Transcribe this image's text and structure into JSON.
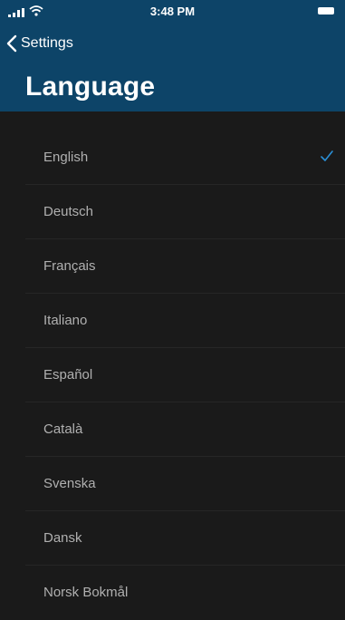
{
  "status_bar": {
    "time": "3:48 PM",
    "signal_icon": "signal-bars-icon",
    "wifi_icon": "wifi-icon",
    "battery_icon": "battery-icon"
  },
  "nav": {
    "back_label": "Settings",
    "back_icon": "chevron-left-icon",
    "title": "Language"
  },
  "languages": [
    {
      "label": "English",
      "selected": true
    },
    {
      "label": "Deutsch",
      "selected": false
    },
    {
      "label": "Français",
      "selected": false
    },
    {
      "label": "Italiano",
      "selected": false
    },
    {
      "label": "Español",
      "selected": false
    },
    {
      "label": "Català",
      "selected": false
    },
    {
      "label": "Svenska",
      "selected": false
    },
    {
      "label": "Dansk",
      "selected": false
    },
    {
      "label": "Norsk Bokmål",
      "selected": false
    }
  ],
  "colors": {
    "header_background": "#0d4468",
    "list_background": "#1a1a1a",
    "checkmark": "#2a8fd6",
    "row_text": "#b0b0b0"
  }
}
